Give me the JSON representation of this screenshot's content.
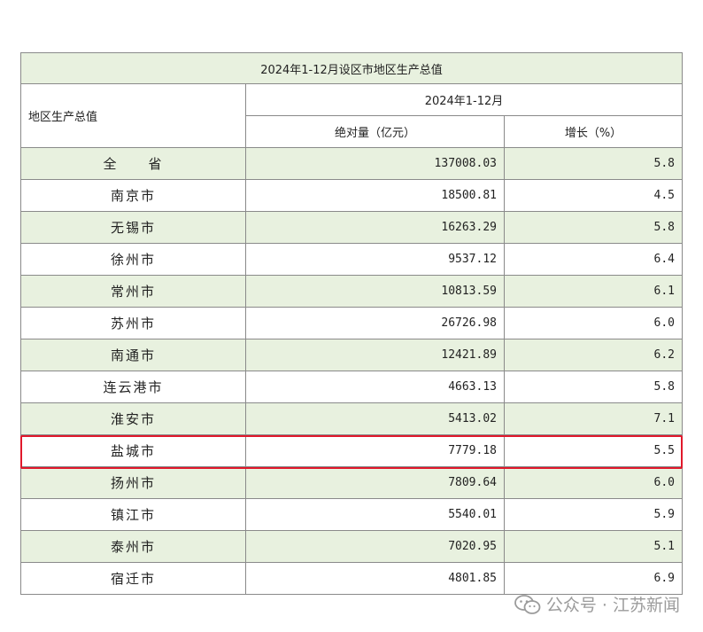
{
  "table": {
    "title": "2024年1-12月设区市地区生产总值",
    "corner_label": "地区生产总值",
    "period_label": "2024年1-12月",
    "col_absolute": "绝对量（亿元）",
    "col_growth": "增长（%）",
    "rows": [
      {
        "name": "全　　省",
        "value": "137008.03",
        "growth": "5.8"
      },
      {
        "name": "南京市",
        "value": "18500.81",
        "growth": "4.5"
      },
      {
        "name": "无锡市",
        "value": "16263.29",
        "growth": "5.8"
      },
      {
        "name": "徐州市",
        "value": "9537.12",
        "growth": "6.4"
      },
      {
        "name": "常州市",
        "value": "10813.59",
        "growth": "6.1"
      },
      {
        "name": "苏州市",
        "value": "26726.98",
        "growth": "6.0"
      },
      {
        "name": "南通市",
        "value": "12421.89",
        "growth": "6.2"
      },
      {
        "name": "连云港市",
        "value": "4663.13",
        "growth": "5.8"
      },
      {
        "name": "淮安市",
        "value": "5413.02",
        "growth": "7.1"
      },
      {
        "name": "盐城市",
        "value": "7779.18",
        "growth": "5.5"
      },
      {
        "name": "扬州市",
        "value": "7809.64",
        "growth": "6.0"
      },
      {
        "name": "镇江市",
        "value": "5540.01",
        "growth": "5.9"
      },
      {
        "name": "泰州市",
        "value": "7020.95",
        "growth": "5.1"
      },
      {
        "name": "宿迁市",
        "value": "4801.85",
        "growth": "6.9"
      }
    ]
  },
  "highlight": {
    "row_name": "盐城市",
    "color": "#e0182b"
  },
  "watermark": {
    "text": "公众号 · 江苏新闻",
    "icon": "wechat-icon"
  },
  "colors": {
    "shade": "#e8f1df",
    "border": "#8a8a8a"
  }
}
